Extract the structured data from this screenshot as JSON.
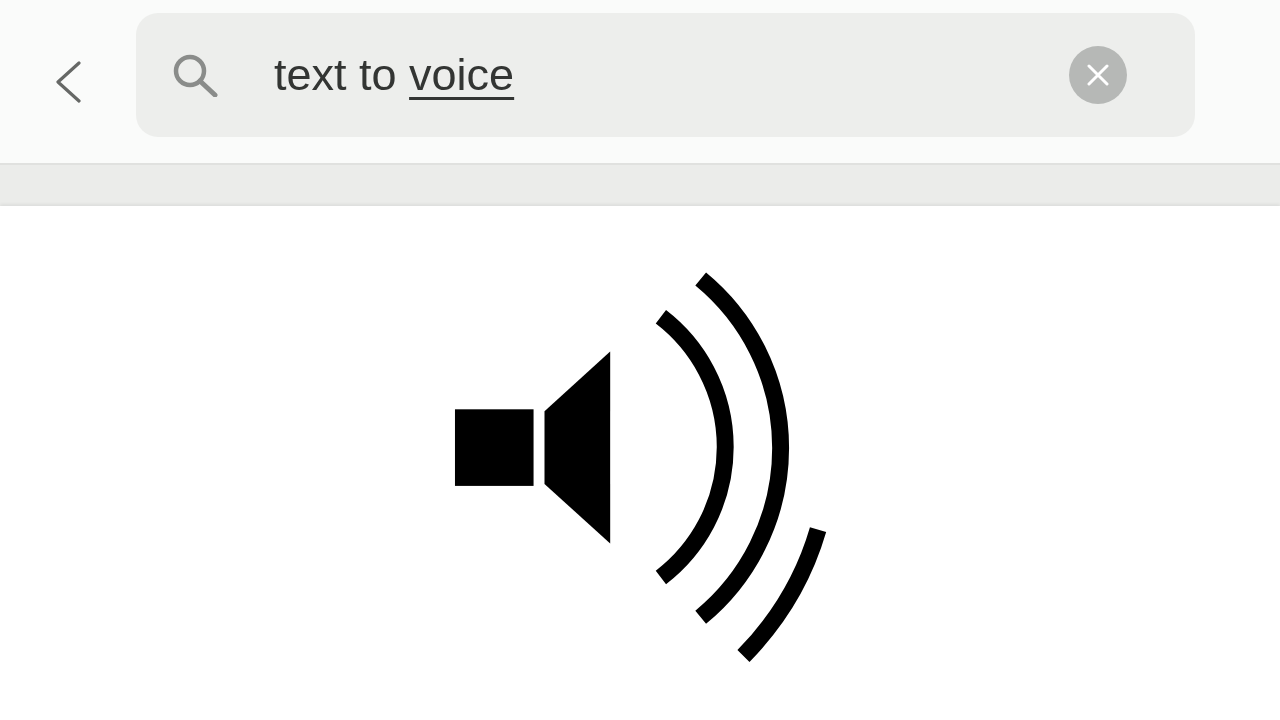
{
  "search": {
    "value_parts": [
      {
        "text": "text to",
        "underlined": false
      },
      {
        "text": "voice",
        "underlined": true
      }
    ]
  }
}
